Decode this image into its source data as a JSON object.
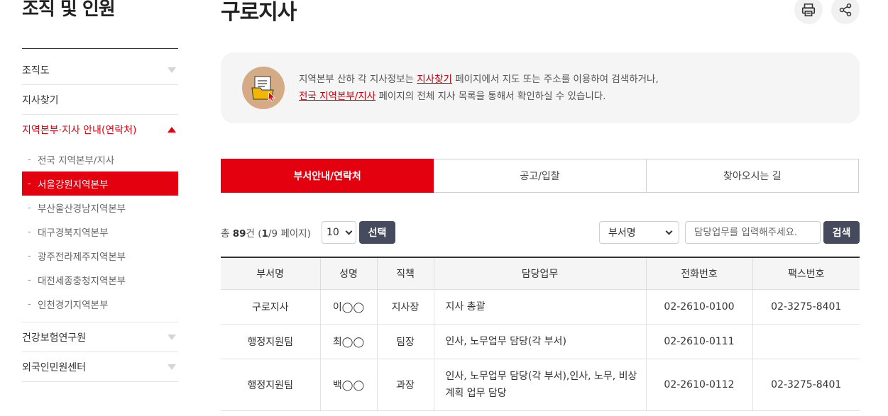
{
  "sidebar": {
    "title": "조직 및 인원",
    "items": [
      {
        "label": "조직도"
      },
      {
        "label": "지사찾기"
      },
      {
        "label": "지역본부·지사 안내(연락처)"
      },
      {
        "label": "건강보험연구원"
      },
      {
        "label": "외국인민원센터"
      }
    ],
    "sub_items": [
      {
        "label": "전국 지역본부/지사"
      },
      {
        "label": "서울강원지역본부"
      },
      {
        "label": "부산울산경남지역본부"
      },
      {
        "label": "대구경북지역본부"
      },
      {
        "label": "광주전라제주지역본부"
      },
      {
        "label": "대전세종충청지역본부"
      },
      {
        "label": "인천경기지역본부"
      }
    ]
  },
  "page": {
    "title": "구로지사",
    "print_icon": "printer-icon",
    "share_icon": "share-icon"
  },
  "notice": {
    "line1_before": "지역본부 산하 각 지사정보는 ",
    "link1": "지사찾기",
    "line1_after": " 페이지에서 지도 또는 주소를 이용하여 검색하거나,",
    "link2": "전국 지역본부/지사",
    "line2_after": " 페이지의 전체 지사 목록을 통해서 확인하실 수 있습니다.",
    "icon": "document-folder-icon"
  },
  "tabs": [
    {
      "label": "부서안내/연락처"
    },
    {
      "label": "공고/입찰"
    },
    {
      "label": "찾아오시는 길"
    }
  ],
  "list": {
    "total_prefix": "총 ",
    "total": "89",
    "total_suffix": "건 (",
    "page_current": "1",
    "page_rest": "/9 페이지)",
    "page_size": "10",
    "select_button": "선택",
    "search_field": "부서명",
    "search_placeholder": "담당업무를 입력해주세요.",
    "search_button": "검색"
  },
  "table": {
    "headers": [
      "부서명",
      "성명",
      "직책",
      "담당업무",
      "전화번호",
      "팩스번호"
    ],
    "rows": [
      [
        "구로지사",
        "이◯◯",
        "지사장",
        "지사 총괄",
        "02-2610-0100",
        "02-3275-8401"
      ],
      [
        "행정지원팀",
        "최◯◯",
        "팀장",
        "인사, 노무업무 담당(각 부서)",
        "02-2610-0111",
        ""
      ],
      [
        "행정지원팀",
        "백◯◯",
        "과장",
        "인사, 노무업무 담당(각 부서),인사, 노무, 비상계획 업무 담당",
        "02-2610-0112",
        "02-3275-8401"
      ]
    ]
  },
  "colors": {
    "accent": "#e3000f",
    "button_dark": "#454a5d"
  }
}
